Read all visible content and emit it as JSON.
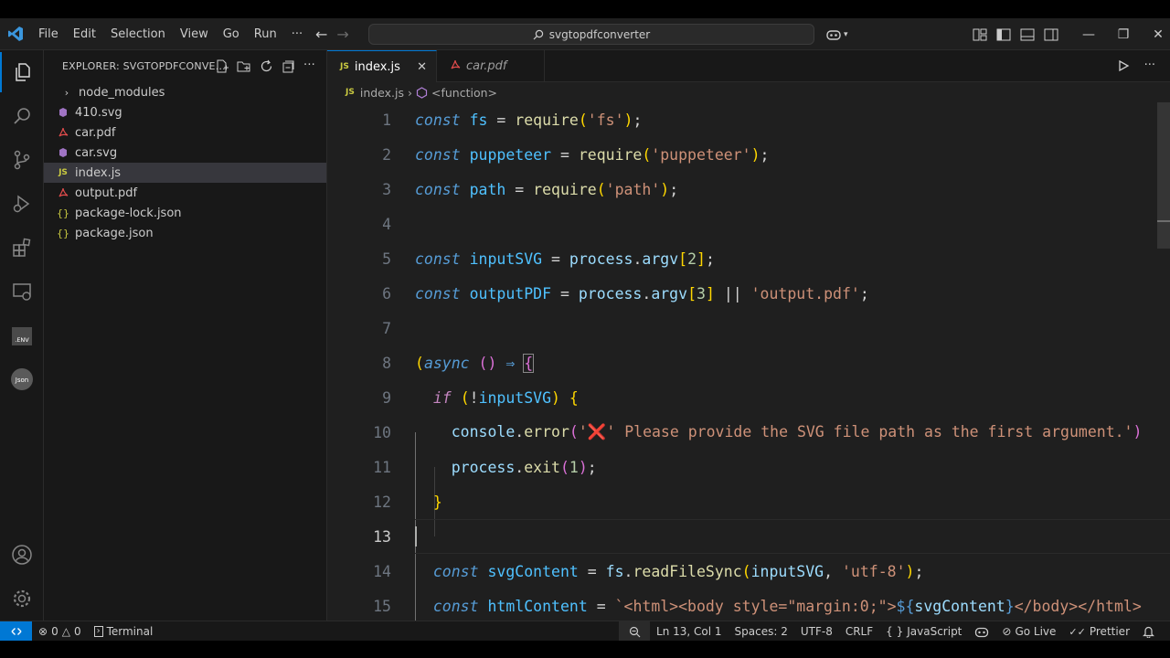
{
  "titlebar": {
    "menu": [
      "File",
      "Edit",
      "Selection",
      "View",
      "Go",
      "Run",
      "···"
    ],
    "search_text": "svgtopdfconverter"
  },
  "explorer": {
    "title": "EXPLORER: SVGTOPDFCONVE...",
    "items": [
      {
        "label": "node_modules",
        "icon": "chevron-right-icon"
      },
      {
        "label": "410.svg",
        "icon": "svg-file-icon"
      },
      {
        "label": "car.pdf",
        "icon": "pdf-file-icon"
      },
      {
        "label": "car.svg",
        "icon": "svg-file-icon"
      },
      {
        "label": "index.js",
        "icon": "js-file-icon"
      },
      {
        "label": "output.pdf",
        "icon": "pdf-file-icon"
      },
      {
        "label": "package-lock.json",
        "icon": "json-file-icon"
      },
      {
        "label": "package.json",
        "icon": "json-file-icon"
      }
    ]
  },
  "tabs": [
    {
      "label": "index.js",
      "badge": "JS",
      "close": "✕"
    },
    {
      "label": "car.pdf"
    }
  ],
  "breadcrumb": {
    "file": "index.js",
    "badge": "JS",
    "symbol": "<function>"
  },
  "code": {
    "line_numbers": [
      "1",
      "2",
      "3",
      "4",
      "5",
      "6",
      "7",
      "8",
      "9",
      "10",
      "11",
      "12",
      "13",
      "14",
      "15"
    ],
    "strings": {
      "fs": "'fs'",
      "puppeteer": "'puppeteer'",
      "path": "'path'",
      "output_pdf": "'output.pdf'",
      "error_msg": "' Please provide the SVG file path as the first argument.'",
      "utf8": "'utf-8'",
      "html_tpl_a": "`<html><body style=\"margin:0;\">",
      "html_tpl_b": "</body></html>"
    },
    "numbers": {
      "argv2": "2",
      "argv3": "3",
      "exit_code": "1"
    },
    "emoji": "❌"
  },
  "statusbar": {
    "errors": "0",
    "warnings": "0",
    "terminal": "Terminal",
    "position": "Ln 13, Col 1",
    "spaces": "Spaces: 2",
    "encoding": "UTF-8",
    "eol": "CRLF",
    "language": "JavaScript",
    "go_live": "Go Live",
    "prettier": "Prettier"
  },
  "colors": {
    "accent": "#0078d4",
    "remote": "#0078d4"
  }
}
